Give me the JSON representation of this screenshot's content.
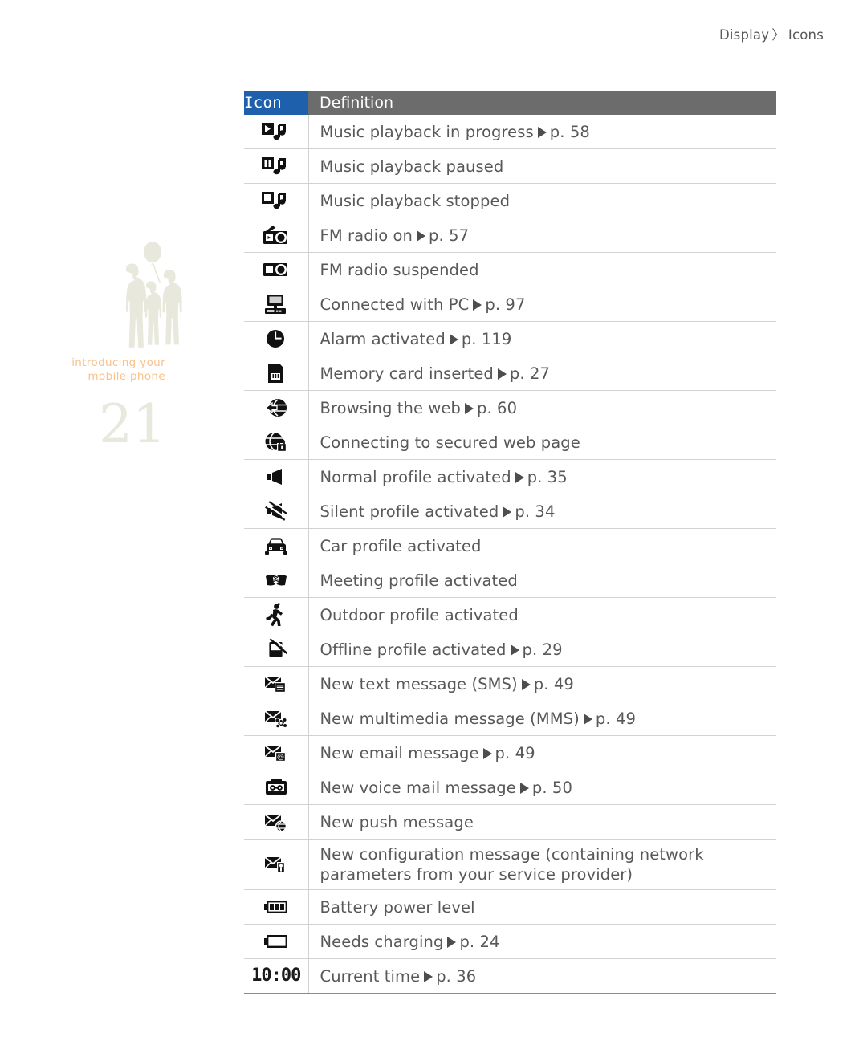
{
  "header": {
    "section": "Display",
    "separator": "〉",
    "subsection": "Icons"
  },
  "sidebar": {
    "caption_line1": "introducing your",
    "caption_line2": "mobile phone",
    "page_number": "21",
    "decoration": "family-silhouette-with-balloon",
    "caption_color": "#f9c089",
    "page_number_color": "#e9e8dd"
  },
  "table": {
    "header_icon": "Icon",
    "header_definition": "Definition",
    "header_icon_bg": "#1f60ad",
    "header_definition_bg": "#6c6c6c",
    "rows": [
      {
        "icon": "music-play-icon",
        "text": "Music playback in progress",
        "page": "p. 58",
        "has_ref": true
      },
      {
        "icon": "music-pause-icon",
        "text": "Music playback paused",
        "page": "",
        "has_ref": false
      },
      {
        "icon": "music-stop-icon",
        "text": "Music playback stopped",
        "page": "",
        "has_ref": false
      },
      {
        "icon": "fm-radio-on-icon",
        "text": "FM radio on",
        "page": "p. 57",
        "has_ref": true
      },
      {
        "icon": "fm-radio-suspended-icon",
        "text": "FM radio suspended",
        "page": "",
        "has_ref": false
      },
      {
        "icon": "pc-connected-icon",
        "text": "Connected with PC",
        "page": "p. 97",
        "has_ref": true
      },
      {
        "icon": "alarm-clock-icon",
        "text": "Alarm activated",
        "page": "p. 119",
        "has_ref": true
      },
      {
        "icon": "memory-card-icon",
        "text": "Memory card inserted",
        "page": "p. 27",
        "has_ref": true
      },
      {
        "icon": "web-browsing-icon",
        "text": "Browsing the web",
        "page": "p. 60",
        "has_ref": true
      },
      {
        "icon": "secure-web-icon",
        "text": "Connecting to secured web page",
        "page": "",
        "has_ref": false
      },
      {
        "icon": "speaker-normal-icon",
        "text": "Normal profile activated",
        "page": "p. 35",
        "has_ref": true
      },
      {
        "icon": "speaker-muted-icon",
        "text": "Silent profile activated",
        "page": "p. 34",
        "has_ref": true
      },
      {
        "icon": "car-icon",
        "text": "Car profile activated",
        "page": "",
        "has_ref": false
      },
      {
        "icon": "handshake-icon",
        "text": "Meeting profile activated",
        "page": "",
        "has_ref": false
      },
      {
        "icon": "running-person-icon",
        "text": "Outdoor profile activated",
        "page": "",
        "has_ref": false
      },
      {
        "icon": "phone-offline-icon",
        "text": "Offline profile activated",
        "page": "p. 29",
        "has_ref": true
      },
      {
        "icon": "sms-envelope-icon",
        "text": "New text message (SMS)",
        "page": "p. 49",
        "has_ref": true
      },
      {
        "icon": "mms-envelope-icon",
        "text": "New multimedia message (MMS)",
        "page": "p. 49",
        "has_ref": true
      },
      {
        "icon": "email-envelope-icon",
        "text": "New email message",
        "page": "p. 49",
        "has_ref": true
      },
      {
        "icon": "voicemail-icon",
        "text": "New voice mail message",
        "page": "p. 50",
        "has_ref": true
      },
      {
        "icon": "push-message-icon",
        "text": "New push message",
        "page": "",
        "has_ref": false
      },
      {
        "icon": "config-message-icon",
        "text": "New configuration message (containing network",
        "text2": "parameters from your service provider)",
        "page": "",
        "has_ref": false
      },
      {
        "icon": "battery-full-icon",
        "text": "Battery power level",
        "page": "",
        "has_ref": false
      },
      {
        "icon": "battery-empty-icon",
        "text": "Needs charging",
        "page": "p. 24",
        "has_ref": true
      },
      {
        "icon": "clock-time-icon",
        "text": "Current time",
        "page": "p. 36",
        "has_ref": true,
        "icon_text": "10:00"
      }
    ]
  }
}
